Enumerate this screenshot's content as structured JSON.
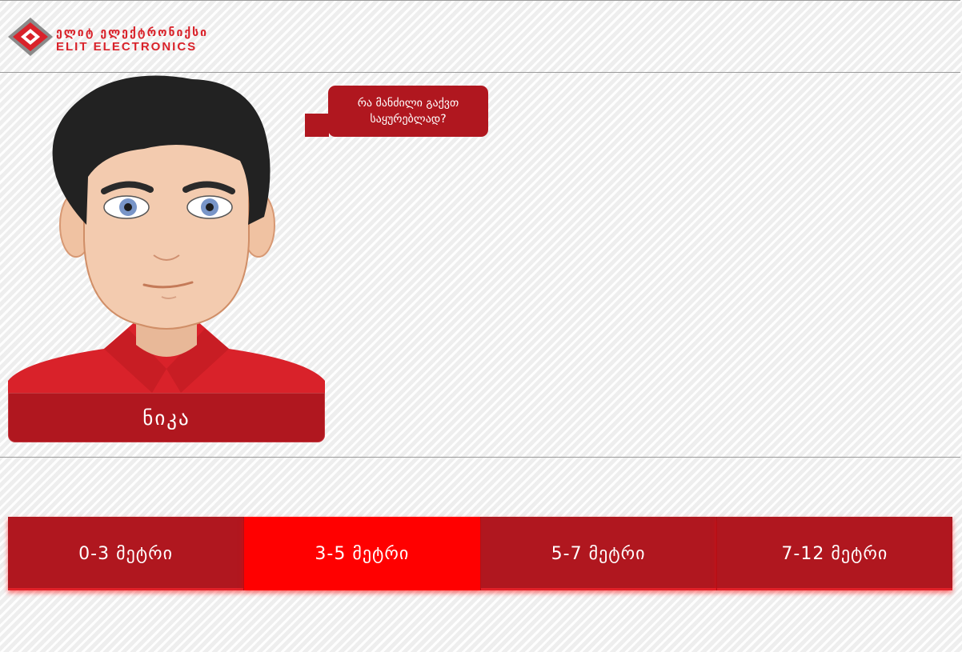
{
  "header": {
    "logo_ka": "ელიტ ელექტრონიქსი",
    "logo_en": "ELIT ELECTRONICS",
    "logo_icon": "elit-logo-icon",
    "brand_color": "#d9222a"
  },
  "assistant": {
    "name": "ნიკა",
    "question": "რა მანძილი გაქვთ საყურებლად?",
    "panel_color": "#b0171f"
  },
  "options": [
    {
      "label": "0-3 მეტრი",
      "selected": false
    },
    {
      "label": "3-5 მეტრი",
      "selected": true
    },
    {
      "label": "5-7 მეტრი",
      "selected": false
    },
    {
      "label": "7-12 მეტრი",
      "selected": false
    }
  ],
  "colors": {
    "option_bg": "#b0171f",
    "option_active": "#ff0000"
  }
}
